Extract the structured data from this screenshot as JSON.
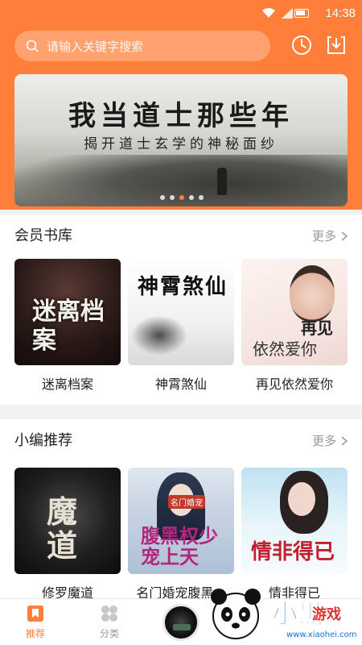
{
  "status_bar": {
    "time": "14:38"
  },
  "search": {
    "placeholder": "请输入关键字搜索"
  },
  "banner": {
    "title": "我当道士那些年",
    "subtitle": "揭开道士玄学的神秘面纱",
    "page_count": 5,
    "active_page": 3
  },
  "sections": [
    {
      "title": "会员书库",
      "more_label": "更多",
      "books": [
        {
          "title": "迷离档案",
          "cover_text": "迷离档案"
        },
        {
          "title": "神霄煞仙",
          "cover_text": "神霄煞仙"
        },
        {
          "title": "再见依然爱你",
          "cover_text_1": "再见",
          "cover_text_2": "依然爱你"
        }
      ]
    },
    {
      "title": "小编推荐",
      "more_label": "更多",
      "books": [
        {
          "title": "修罗魔道",
          "cover_text": "魔道"
        },
        {
          "title": "名门婚宠腹黑...",
          "cover_tag": "名门婚宠",
          "cover_text": "腹黑权少宠上天"
        },
        {
          "title": "情非得已",
          "cover_text": "情非得已"
        }
      ]
    }
  ],
  "tabbar": {
    "tabs": [
      {
        "label": "推荐",
        "active": true
      },
      {
        "label": "分类",
        "active": false
      }
    ]
  },
  "watermark": {
    "brand": "小黑",
    "sub": "游戏",
    "url": "www.xiaohei.com"
  },
  "colors": {
    "accent": "#ff7f3a",
    "text": "#222222",
    "muted": "#999999"
  }
}
